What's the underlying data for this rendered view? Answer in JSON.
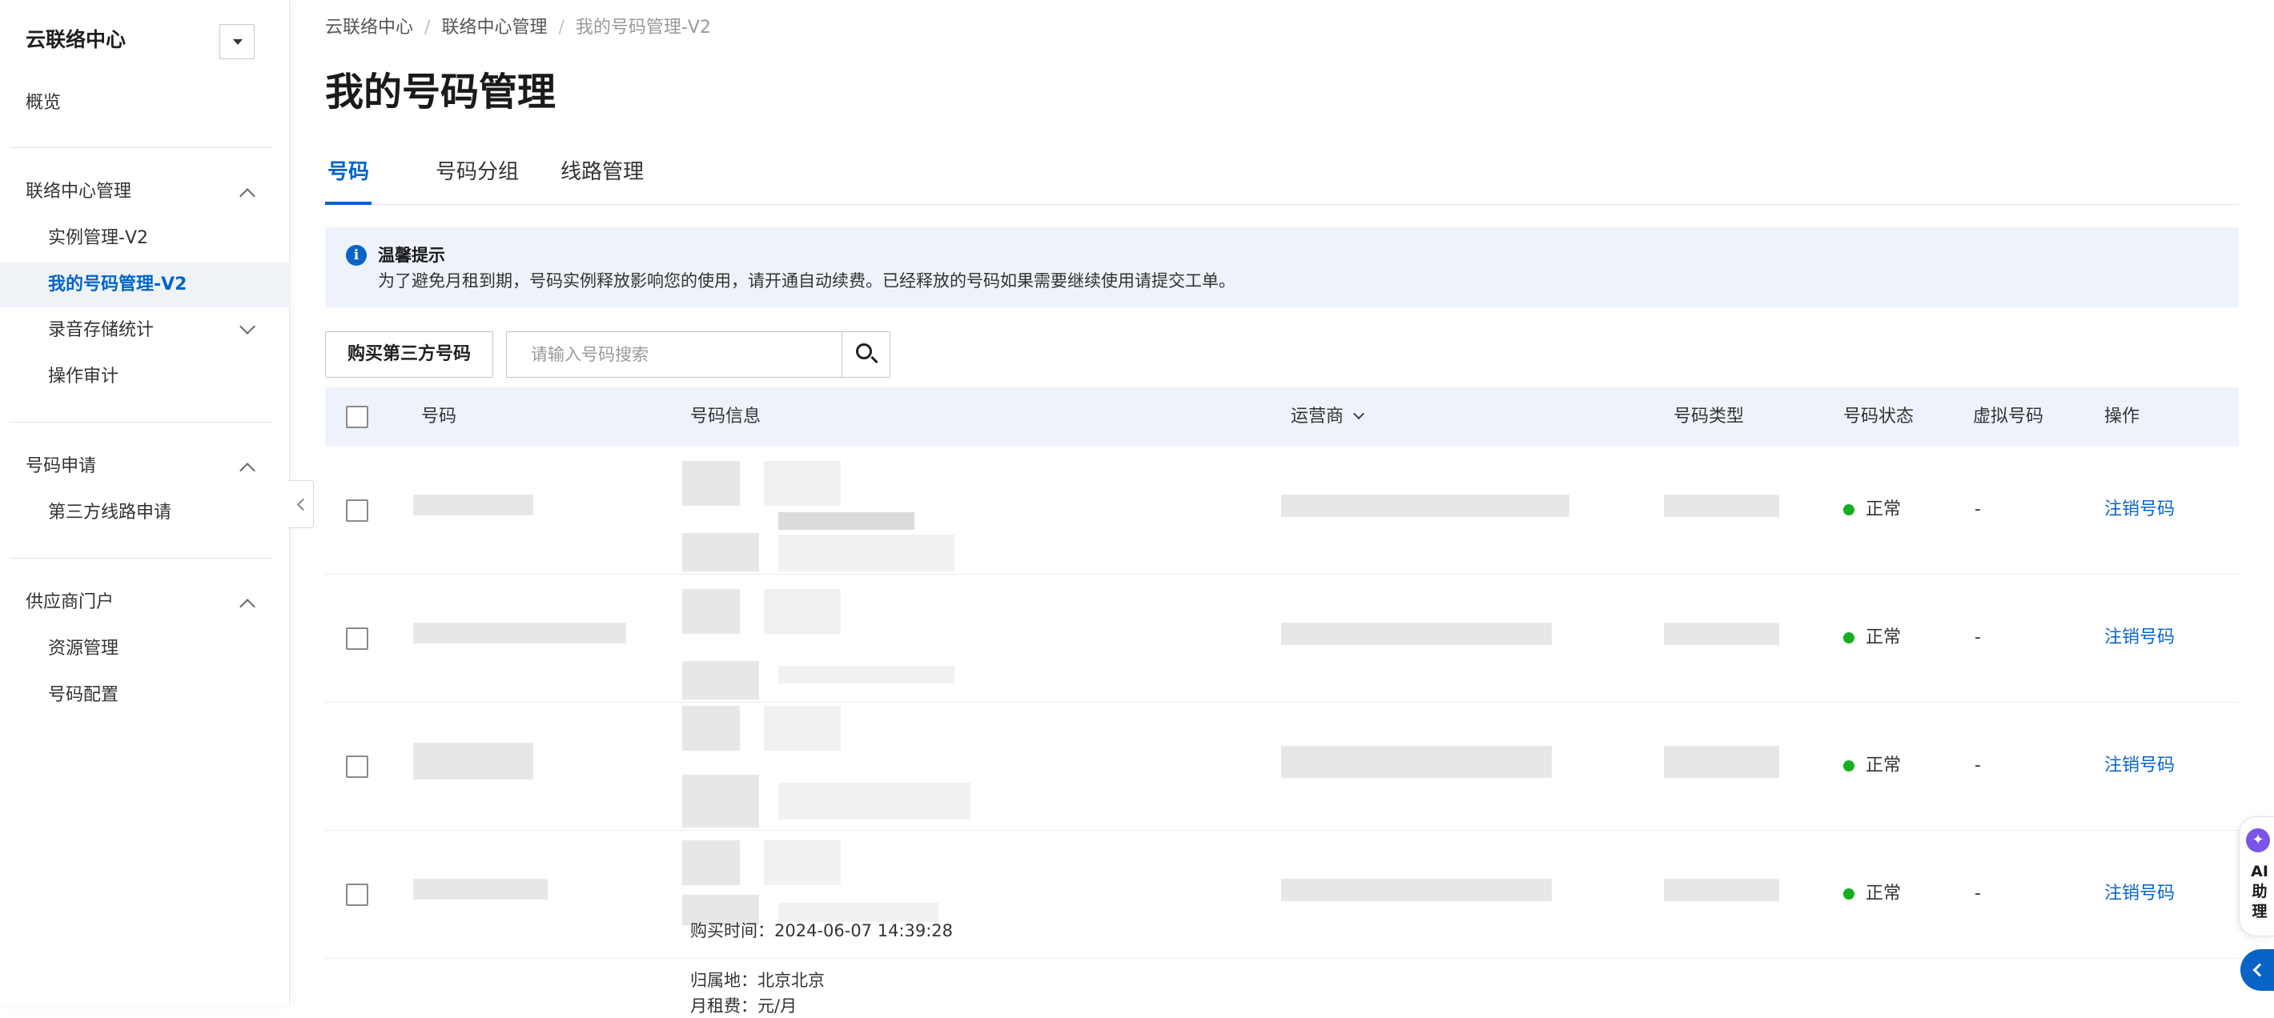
{
  "sidebar": {
    "title": "云联络中心",
    "overview": "概览",
    "groups": [
      {
        "label": "联络中心管理",
        "items": [
          "实例管理-V2",
          "我的号码管理-V2",
          "录音存储统计",
          "操作审计"
        ]
      },
      {
        "label": "号码申请",
        "items": [
          "第三方线路申请"
        ]
      },
      {
        "label": "供应商门户",
        "items": [
          "资源管理",
          "号码配置"
        ]
      }
    ],
    "active_item": "我的号码管理-V2"
  },
  "breadcrumb": [
    "云联络中心",
    "联络中心管理",
    "我的号码管理-V2"
  ],
  "page_title": "我的号码管理",
  "tabs": [
    "号码",
    "号码分组",
    "线路管理"
  ],
  "active_tab": "号码",
  "notice": {
    "title": "温馨提示",
    "text": "为了避免月租到期，号码实例释放影响您的使用，请开通自动续费。已经释放的号码如果需要继续使用请提交工单。"
  },
  "toolbar": {
    "buy_button": "购买第三方号码",
    "search_placeholder": "请输入号码搜索"
  },
  "table": {
    "columns": [
      "号码",
      "号码信息",
      "运营商",
      "号码类型",
      "号码状态",
      "虚拟号码",
      "操作"
    ],
    "rows": [
      {
        "status": "正常",
        "virtual": "-",
        "action": "注销号码"
      },
      {
        "status": "正常",
        "virtual": "-",
        "action": "注销号码"
      },
      {
        "status": "正常",
        "virtual": "-",
        "action": "注销号码"
      },
      {
        "status": "正常",
        "virtual": "-",
        "action": "注销号码"
      }
    ],
    "overflow_info": {
      "purchase_time": "购买时间：2024-06-07 14:39:28",
      "location": "归属地：北京北京",
      "monthly_fee": "月租费：元/月"
    }
  },
  "ai_assistant": {
    "label": "AI助理"
  },
  "colors": {
    "accent": "#0064c8",
    "status_ok": "#12b01a",
    "notice_bg": "#eef3fb"
  },
  "icons": [
    "chevron-up-icon",
    "chevron-down-icon",
    "info-icon",
    "search-icon",
    "sort-caret-icon",
    "collapse-arrow-icon",
    "ai-logo-icon"
  ]
}
